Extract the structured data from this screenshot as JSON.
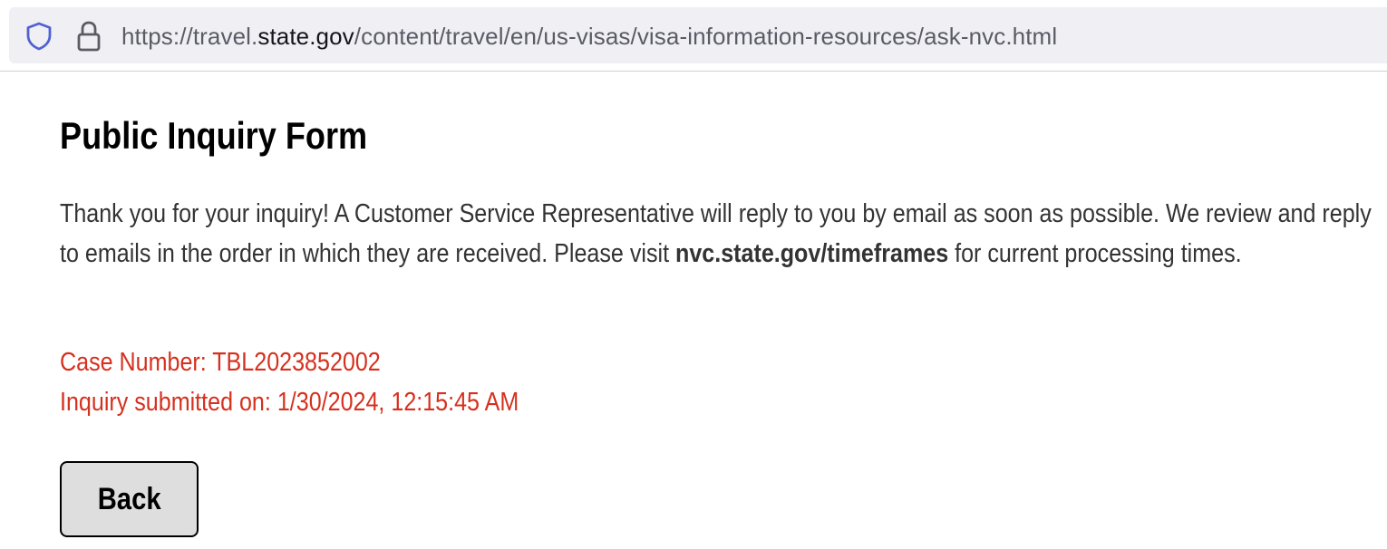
{
  "browser": {
    "url_prefix": "https://travel.",
    "url_domain": "state.gov",
    "url_path": "/content/travel/en/us-visas/visa-information-resources/ask-nvc.html",
    "shield_icon": "shield-icon",
    "lock_icon": "lock-icon",
    "shield_color": "#5061d4"
  },
  "page": {
    "title": "Public Inquiry Form",
    "message_part1": "Thank you for your inquiry! A Customer Service Representative will reply to you by email as soon as possible. We review and reply to emails in the order in which they are received. Please visit ",
    "message_link": "nvc.state.gov/timeframes",
    "message_part2": " for current processing times.",
    "case_number": "Case Number: TBL2023852002",
    "submitted_on": "Inquiry submitted on: 1/30/2024, 12:15:45 AM",
    "back_label": "Back",
    "alert_color": "#d6301e"
  }
}
